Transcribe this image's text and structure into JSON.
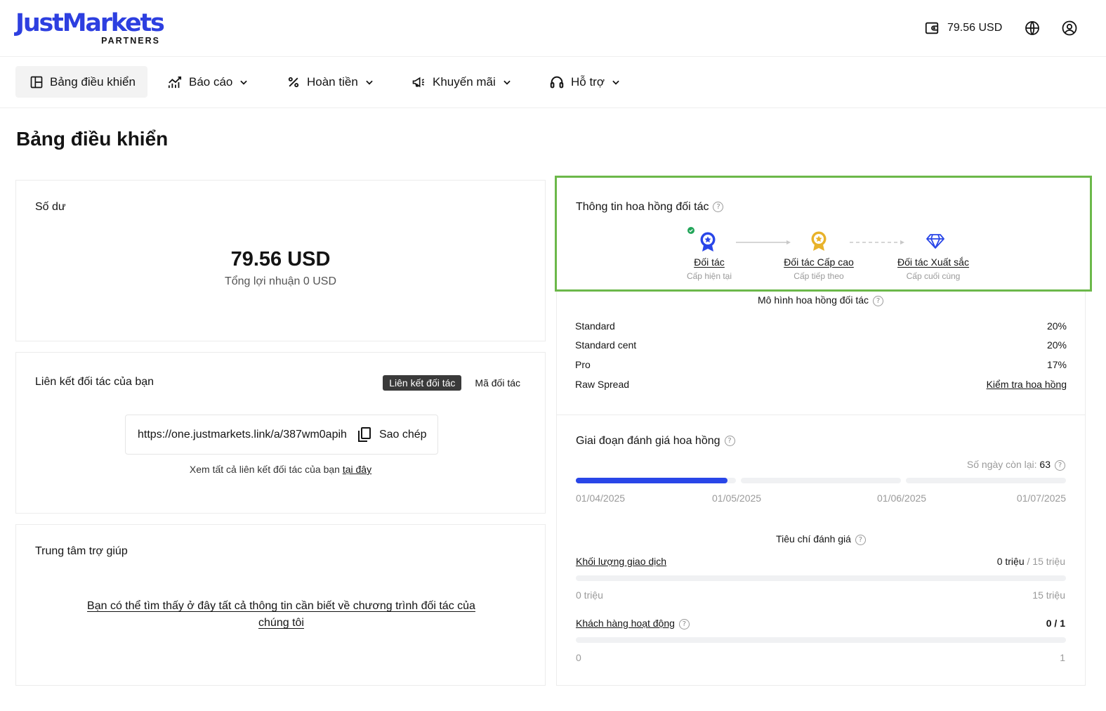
{
  "header": {
    "logo": "JustMarkets",
    "logo_sub": "PARTNERS",
    "balance": "79.56 USD",
    "icons": [
      "wallet-icon",
      "globe-icon",
      "user-icon"
    ]
  },
  "nav": {
    "items": [
      {
        "label": "Bảng điều khiển",
        "icon": "dashboard-icon"
      },
      {
        "label": "Báo cáo",
        "icon": "chart-icon"
      },
      {
        "label": "Hoàn tiền",
        "icon": "percent-icon"
      },
      {
        "label": "Khuyến mãi",
        "icon": "megaphone-icon"
      },
      {
        "label": "Hỗ trợ",
        "icon": "headset-icon"
      }
    ]
  },
  "page_title": "Bảng điều khiển",
  "balance_card": {
    "title": "Số dư",
    "amount": "79.56 USD",
    "profit": "Tổng lợi nhuận 0 USD"
  },
  "link_card": {
    "title": "Liên kết đối tác của bạn",
    "tabs": [
      "Liên kết đối tác",
      "Mã đối tác"
    ],
    "url": "https://one.justmarkets.link/a/387wm0apih",
    "copy": "Sao chép",
    "note": "Xem tất cả liên kết đối tác của bạn",
    "note_link": "tại đây"
  },
  "help_card": {
    "title": "Trung tâm trợ giúp",
    "link": "Bạn có thể tìm thấy ở đây tất cả thông tin cần biết về chương trình đối tác của chúng tôi"
  },
  "commission_info": {
    "title": "Thông tin hoa hồng đối tác",
    "levels": [
      {
        "name": "Đối tác",
        "sub": "Cấp hiện tại"
      },
      {
        "name": "Đối tác Cấp cao",
        "sub": "Cấp tiếp theo"
      },
      {
        "name": "Đối tác Xuất sắc",
        "sub": "Cấp cuối cùng"
      }
    ]
  },
  "commission_model": {
    "title": "Mô hình hoa hồng đối tác",
    "rows": [
      {
        "name": "Standard",
        "value": "20%"
      },
      {
        "name": "Standard cent",
        "value": "20%"
      },
      {
        "name": "Pro",
        "value": "17%"
      },
      {
        "name": "Raw Spread",
        "value": "Kiểm tra hoa hồng"
      }
    ]
  },
  "evaluation": {
    "title": "Giai đoạn đánh giá hoa hồng",
    "days_label": "Số ngày còn lại:",
    "days": "63",
    "progress": 0.31,
    "dates": [
      "01/04/2025",
      "01/05/2025",
      "01/06/2025",
      "01/07/2025"
    ],
    "criteria_title": "Tiêu chí đánh giá",
    "criteria": [
      {
        "name": "Khối lượng giao dịch",
        "current": "0 triệu",
        "target": "/ 15 triệu",
        "min": "0 triệu",
        "max": "15 triệu"
      },
      {
        "name": "Khách hàng hoạt động",
        "value": "0 / 1",
        "min": "0",
        "max": "1"
      }
    ]
  },
  "colors": {
    "brand": "#2d3fe0",
    "highlight": "#6cb84a",
    "progress": "#2946e8",
    "gold": "#e8b22a"
  }
}
